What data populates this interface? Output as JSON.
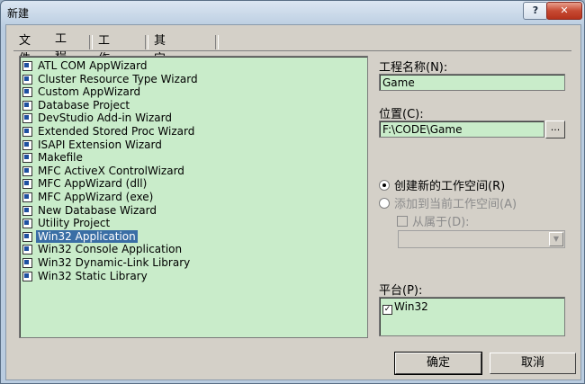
{
  "window": {
    "title": "新建",
    "help_label": "?",
    "close_label": "✕"
  },
  "tabs": [
    {
      "label": "文件"
    },
    {
      "label": "工程"
    },
    {
      "label": "工作区"
    },
    {
      "label": "其它文档"
    }
  ],
  "projects": [
    {
      "label": "ATL COM AppWizard",
      "icon": "atl-icon"
    },
    {
      "label": "Cluster Resource Type Wizard",
      "icon": "cluster-icon"
    },
    {
      "label": "Custom AppWizard",
      "icon": "custom-wizard-icon"
    },
    {
      "label": "Database Project",
      "icon": "database-icon"
    },
    {
      "label": "DevStudio Add-in Wizard",
      "icon": "addin-icon"
    },
    {
      "label": "Extended Stored Proc Wizard",
      "icon": "stored-proc-icon"
    },
    {
      "label": "ISAPI Extension Wizard",
      "icon": "isapi-icon"
    },
    {
      "label": "Makefile",
      "icon": "makefile-icon"
    },
    {
      "label": "MFC ActiveX ControlWizard",
      "icon": "activex-icon"
    },
    {
      "label": "MFC AppWizard (dll)",
      "icon": "mfc-dll-icon"
    },
    {
      "label": "MFC AppWizard (exe)",
      "icon": "mfc-exe-icon"
    },
    {
      "label": "New Database Wizard",
      "icon": "new-database-icon"
    },
    {
      "label": "Utility Project",
      "icon": "utility-icon"
    },
    {
      "label": "Win32 Application",
      "icon": "win32-app-icon",
      "selected": true
    },
    {
      "label": "Win32 Console Application",
      "icon": "console-icon"
    },
    {
      "label": "Win32 Dynamic-Link Library",
      "icon": "dll-icon"
    },
    {
      "label": "Win32 Static Library",
      "icon": "static-lib-icon"
    }
  ],
  "form": {
    "project_name_label": "工程名称(N):",
    "project_name_value": "Game",
    "location_label": "位置(C):",
    "location_value": "F:\\CODE\\Game",
    "browse_label": "...",
    "radio_new_workspace": "创建新的工作空间(R)",
    "radio_add_workspace": "添加到当前工作空间(A)",
    "dependency_label": "从属于(D):",
    "dependency_value": "",
    "platform_label": "平台(P):",
    "platform_value": "Win32"
  },
  "buttons": {
    "ok": "确定",
    "cancel": "取消"
  },
  "colors": {
    "list_background": "#c9ecca",
    "selection": "#3a6ea5",
    "dialog_face": "#d4d0c8"
  }
}
